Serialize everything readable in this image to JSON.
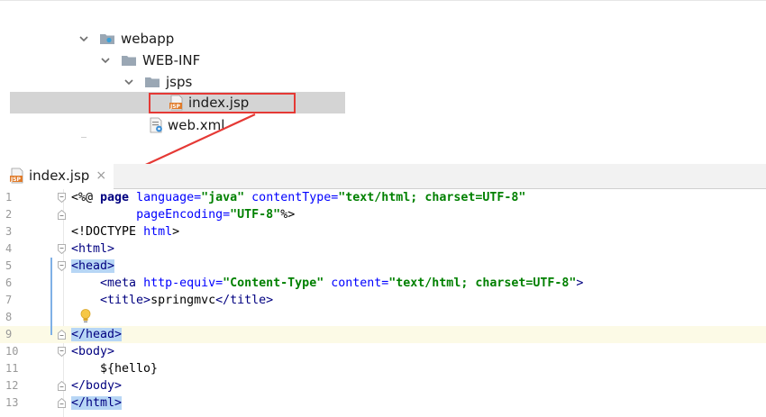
{
  "tree": {
    "items": [
      {
        "label": "webapp",
        "type": "folder"
      },
      {
        "label": "WEB-INF",
        "type": "folder"
      },
      {
        "label": "jsps",
        "type": "folder"
      },
      {
        "label": "index.jsp",
        "type": "jsp",
        "selected": true
      },
      {
        "label": "web.xml",
        "type": "xml"
      }
    ]
  },
  "editor": {
    "tab_label": "index.jsp",
    "tab_close": "×",
    "line_numbers": [
      "1",
      "2",
      "3",
      "4",
      "5",
      "6",
      "7",
      "8",
      "9",
      "10",
      "11",
      "12",
      "13"
    ],
    "current_line": 9,
    "lines": {
      "l1": {
        "open": "<%@ ",
        "kw": "page",
        "a1": " language=",
        "v1": "\"java\"",
        "a2": " contentType=",
        "v2": "\"text/html; charset=UTF-8\""
      },
      "l2": {
        "indent": "         ",
        "a1": "pageEncoding=",
        "v1": "\"UTF-8\"",
        "close": "%>"
      },
      "l3": {
        "text1": "<!DOCTYPE ",
        "text2": "html",
        "text3": ">"
      },
      "l4": {
        "text": "<html>"
      },
      "l5": {
        "text": "<head>"
      },
      "l6": {
        "open": "    <meta ",
        "a1": "http-equiv=",
        "v1": "\"Content-Type\"",
        "a2": " content=",
        "v2": "\"text/html; charset=UTF-8\"",
        "close": ">"
      },
      "l7": {
        "open": "    <title>",
        "mid": "springmvc",
        "close": "</title>"
      },
      "l9": {
        "text": "</head>"
      },
      "l10": {
        "text": "<body>"
      },
      "l11": {
        "text": "    ${hello}"
      },
      "l12": {
        "text": "</body>"
      },
      "l13": {
        "text": "</html>"
      }
    }
  },
  "colors": {
    "selection_box": "#e53935",
    "tag": "#000080",
    "attribute": "#0000ff",
    "string": "#008000",
    "tag_highlight": "#b7d6f5",
    "current_line": "#fcfae6"
  }
}
